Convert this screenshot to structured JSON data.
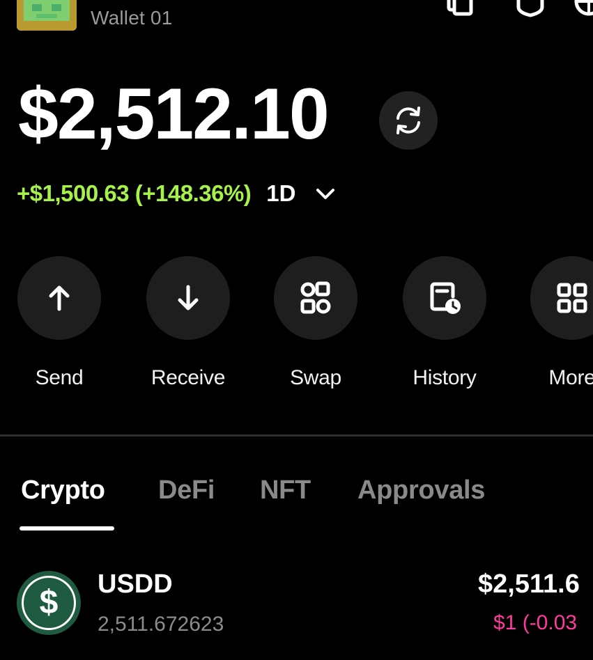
{
  "header": {
    "wallet_name": "Wallet 01",
    "icons": [
      "copy-icon",
      "shield-icon",
      "globe-icon"
    ]
  },
  "balance": {
    "total": "$2,512.10",
    "change": "+$1,500.63 (+148.36%)",
    "period": "1D",
    "colors": {
      "positive": "#a6f14a"
    }
  },
  "actions": [
    {
      "label": "Send",
      "icon": "arrow-up-icon"
    },
    {
      "label": "Receive",
      "icon": "arrow-down-icon"
    },
    {
      "label": "Swap",
      "icon": "swap-icon"
    },
    {
      "label": "History",
      "icon": "history-icon"
    },
    {
      "label": "More",
      "icon": "grid-icon"
    }
  ],
  "tabs": [
    {
      "label": "Crypto",
      "active": true
    },
    {
      "label": "DeFi",
      "active": false
    },
    {
      "label": "NFT",
      "active": false
    },
    {
      "label": "Approvals",
      "active": false
    }
  ],
  "assets": [
    {
      "symbol": "USDD",
      "amount": "2,511.672623",
      "value": "$2,511.6",
      "price_change": "$1 (-0.03",
      "icon": "dollar-icon",
      "colors": {
        "logo": "#1f5b41",
        "change": "#ff3b9d"
      }
    }
  ]
}
